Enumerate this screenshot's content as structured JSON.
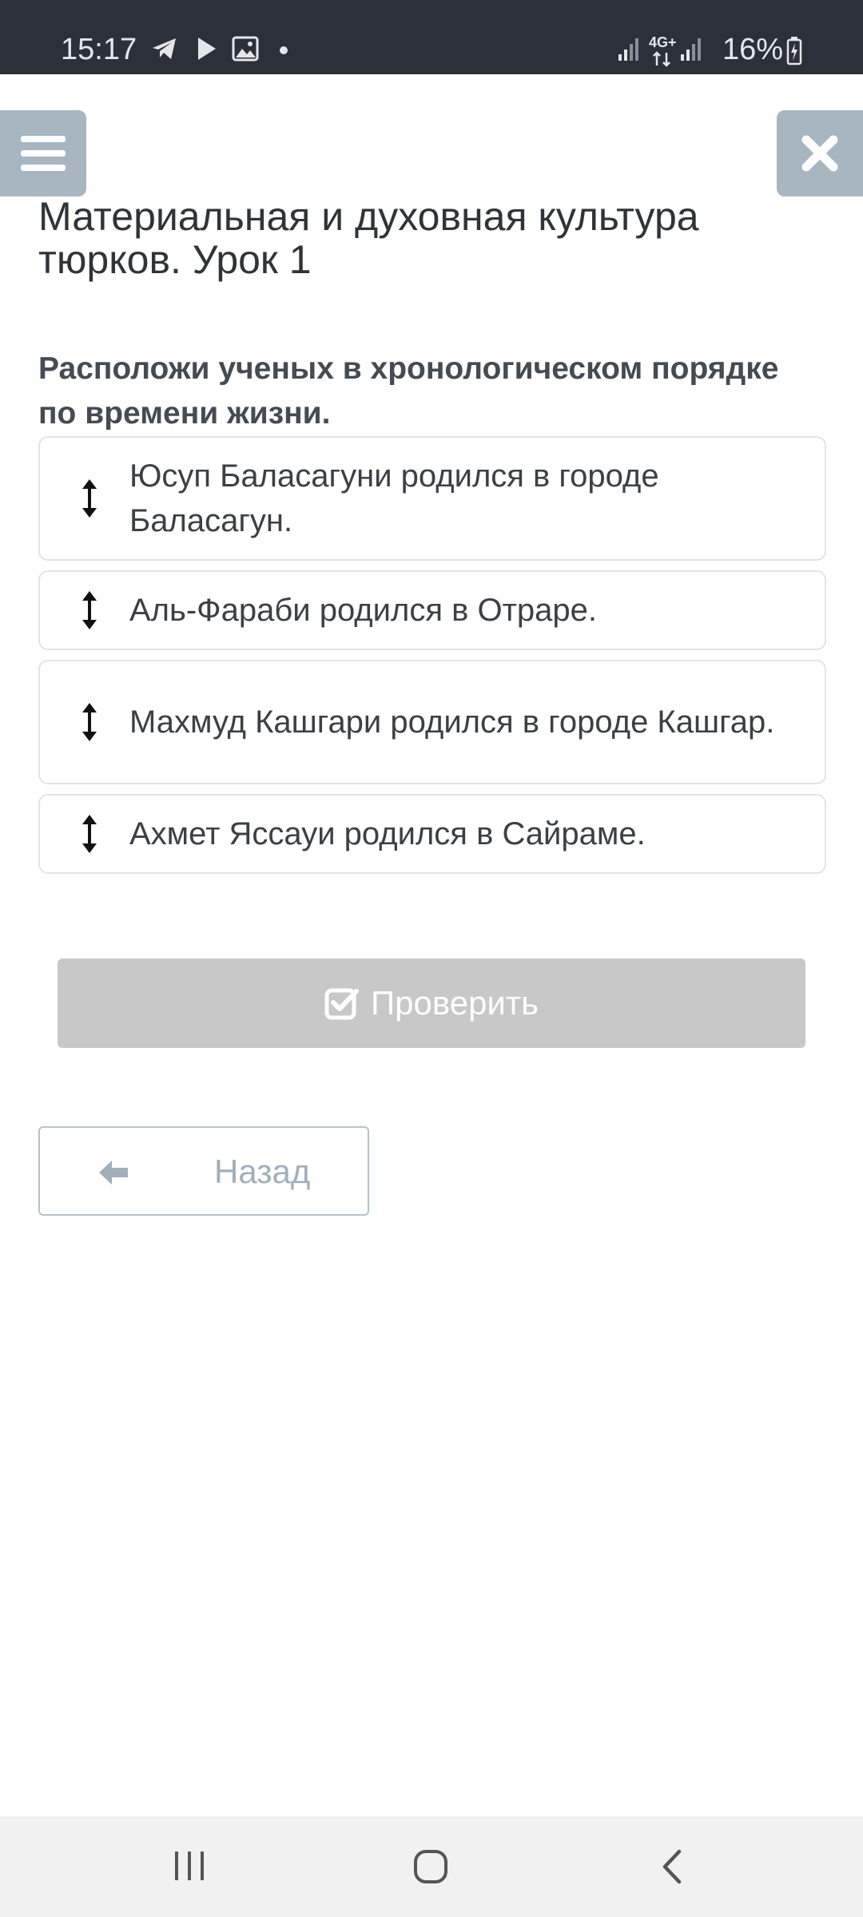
{
  "status_bar": {
    "time": "15:17",
    "icons": [
      "telegram-icon",
      "play-icon",
      "image-icon",
      "dot-icon"
    ],
    "network": "4G+",
    "battery": "16%"
  },
  "header": {
    "menu_icon": "hamburger-menu-icon",
    "close_icon": "close-icon"
  },
  "page": {
    "title": "Материальная и духовная культура тюрков. Урок 1",
    "question": "Расположи ученых в хронологическом порядке по времени жизни."
  },
  "sort_items": [
    {
      "text": "Юсуп Баласагуни родился в городе Баласагун."
    },
    {
      "text": "Аль-Фараби родился в Отраре."
    },
    {
      "text": "Махмуд Кашгари родился в городе Кашгар."
    },
    {
      "text": "Ахмет Яссауи родился в Сайраме."
    }
  ],
  "actions": {
    "check_label": "Проверить",
    "back_label": "Назад"
  },
  "colors": {
    "status_bar_bg": "#2c3139",
    "icon_button_bg": "#a7b6c1",
    "check_button_bg": "#c8c8c8",
    "back_button_border": "#b5c3cd"
  },
  "nav_bar": {
    "icons": [
      "recent-apps-icon",
      "home-icon",
      "back-nav-icon"
    ]
  }
}
